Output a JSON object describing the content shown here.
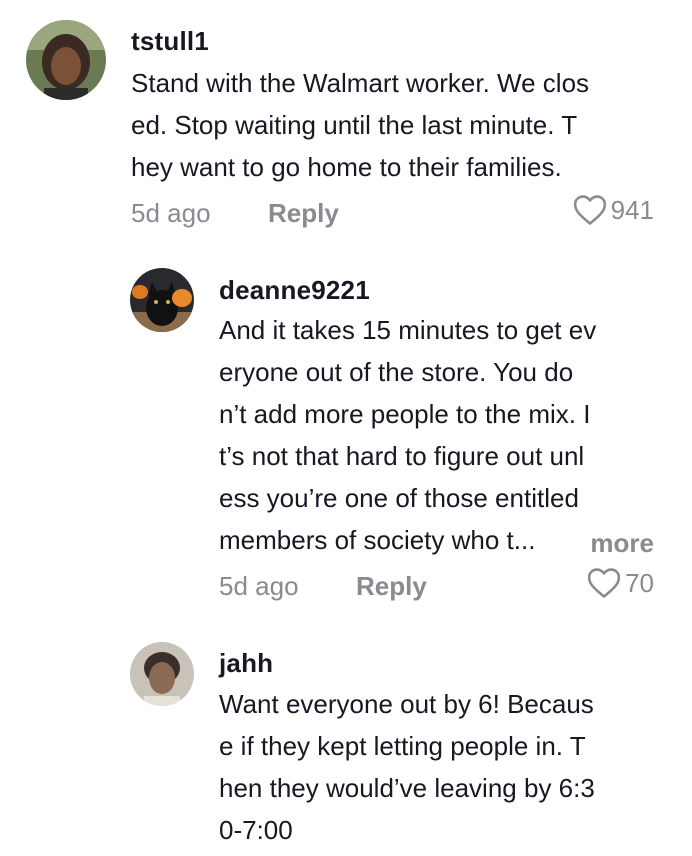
{
  "comments": [
    {
      "username": "tstull1",
      "lines": [
        "Stand with the Walmart worker. We clos",
        "ed. Stop waiting until the last minute. T",
        "hey want to go home to their families."
      ],
      "time": "5d ago",
      "reply_label": "Reply",
      "likes": "941",
      "avatar_icon": "user-avatar"
    },
    {
      "username": "deanne9221",
      "lines": [
        "And it takes 15 minutes to get ev",
        "eryone out of the store. You do",
        "n’t add more people to the mix. I",
        "t’s not that hard to figure out unl",
        "ess you’re one of those entitled",
        "members of society who t..."
      ],
      "more_label": "more",
      "time": "5d ago",
      "reply_label": "Reply",
      "likes": "70",
      "avatar_icon": "cat-pumpkin-avatar"
    },
    {
      "username": "jahh",
      "lines": [
        "Want everyone out by 6! Becaus",
        "e if they kept letting people in. T",
        "hen they would’ve leaving by 6:3",
        "0-7:00"
      ],
      "avatar_icon": "user-avatar"
    }
  ],
  "colors": {
    "text": "#161823",
    "muted": "#8a8b91",
    "background": "#ffffff"
  },
  "icons": {
    "like": "heart-outline-icon"
  }
}
